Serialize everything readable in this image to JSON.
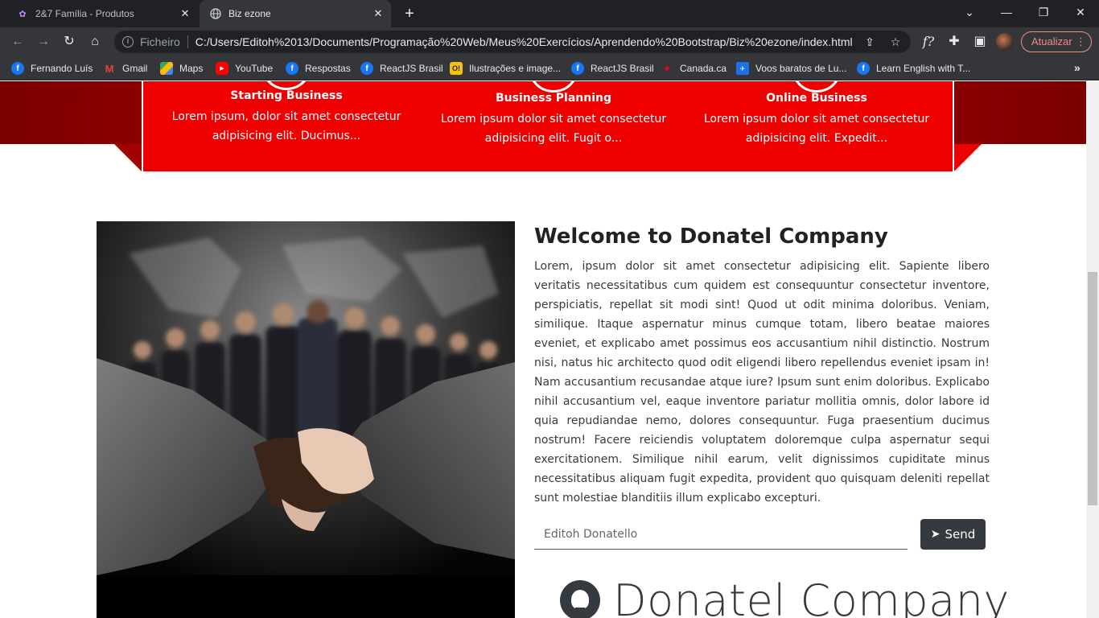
{
  "browser": {
    "tabs": [
      {
        "title": "2&7 Família - Produtos",
        "active": false
      },
      {
        "title": "Biz ezone",
        "active": true
      }
    ],
    "address": {
      "scheme": "Ficheiro",
      "url": "C:/Users/Editoh%2013/Documents/Programação%20Web/Meus%20Exercícios/Aprendendo%20Bootstrap/Biz%20ezone/index.html"
    },
    "update_button": "Atualizar",
    "bookmarks": [
      {
        "label": "Fernando Luís",
        "icon": "facebook-icon"
      },
      {
        "label": "Gmail",
        "icon": "gmail-icon"
      },
      {
        "label": "Maps",
        "icon": "maps-icon"
      },
      {
        "label": "YouTube",
        "icon": "youtube-icon"
      },
      {
        "label": "Respostas",
        "icon": "facebook-icon"
      },
      {
        "label": "ReactJS Brasil",
        "icon": "facebook-icon"
      },
      {
        "label": "Ilustrações e image...",
        "icon": "illustration-icon"
      },
      {
        "label": "ReactJS Brasil",
        "icon": "facebook-icon"
      },
      {
        "label": "Canada.ca",
        "icon": "maple-leaf-icon"
      },
      {
        "label": "Voos baratos de Lu...",
        "icon": "flights-icon"
      },
      {
        "label": "Learn English with T...",
        "icon": "facebook-icon"
      }
    ]
  },
  "services": [
    {
      "title": "Starting Business",
      "desc": "Lorem ipsum, dolor sit amet consectetur adipisicing elit. Ducimus..."
    },
    {
      "title": "Business Planning",
      "desc": "Lorem ipsum dolor sit amet consectetur adipisicing elit. Fugit o..."
    },
    {
      "title": "Online Business",
      "desc": "Lorem ipsum dolor sit amet consectetur adipisicing elit. Expedit..."
    }
  ],
  "about": {
    "heading": "Welcome to Donatel Company",
    "body": "Lorem, ipsum dolor sit amet consectetur adipisicing elit. Sapiente libero veritatis necessitatibus cum quidem est consequuntur consectetur inventore, perspiciatis, repellat sit modi sint! Quod ut odit minima doloribus. Veniam, similique. Itaque aspernatur minus cumque totam, libero beatae maiores eveniet, et explicabo amet possimus eos accusantium nihil distinctio. Nostrum nisi, natus hic architecto quod odit eligendi libero repellendus eveniet ipsam in! Nam accusantium recusandae atque iure? Ipsum sunt enim doloribus. Explicabo nihil accusantium vel, eaque inventore pariatur mollitia omnis, dolor labore id quia repudiandae nemo, dolores consequuntur. Fuga praesentium ducimus nostrum! Facere reiciendis voluptatem doloremque culpa aspernatur sequi exercitationem. Similique nihil earum, velit dignissimos cupiditate minus necessitatibus aliquam fugit expedita, provident quo quisquam deleniti repellat sunt molestiae blanditiis illum explicabo excepturi."
  },
  "form": {
    "name_placeholder": "Editoh Donatello",
    "send_label": "Send"
  },
  "brand": {
    "name": "Donatel Company",
    "icon": "github-icon"
  },
  "colors": {
    "accent_red": "#ee0000",
    "dark_red": "#a30000",
    "button_dark": "#343a40"
  }
}
